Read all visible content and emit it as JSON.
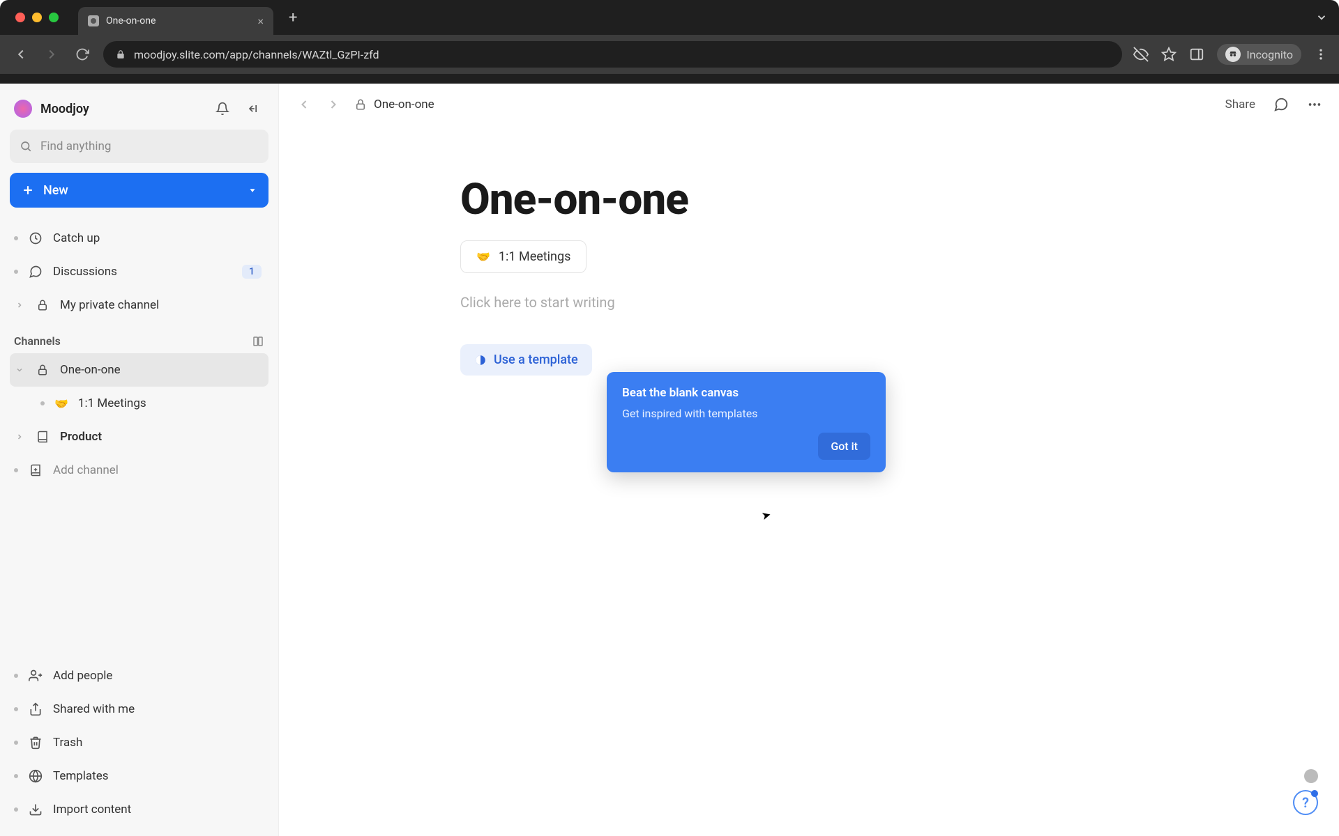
{
  "browser": {
    "tab_title": "One-on-one",
    "url": "moodjoy.slite.com/app/channels/WAZtl_GzPI-zfd",
    "incognito_label": "Incognito"
  },
  "workspace": {
    "name": "Moodjoy"
  },
  "search": {
    "placeholder": "Find anything"
  },
  "new_button": {
    "label": "New"
  },
  "sidebar": {
    "catch_up": "Catch up",
    "discussions": "Discussions",
    "discussions_badge": "1",
    "private_channel": "My private channel",
    "channels_header": "Channels",
    "one_on_one": "One-on-one",
    "meetings_emoji": "🤝",
    "meetings": "1:1 Meetings",
    "product": "Product",
    "add_channel": "Add channel",
    "add_people": "Add people",
    "shared_with_me": "Shared with me",
    "trash": "Trash",
    "templates": "Templates",
    "import_content": "Import content"
  },
  "topbar": {
    "breadcrumb": "One-on-one",
    "share": "Share"
  },
  "page": {
    "title": "One-on-one",
    "chip_emoji": "🤝",
    "chip_label": "1:1 Meetings",
    "placeholder": "Click here to start writing",
    "template_btn": "Use a template"
  },
  "popover": {
    "title": "Beat the blank canvas",
    "body": "Get inspired with templates",
    "action": "Got it"
  }
}
